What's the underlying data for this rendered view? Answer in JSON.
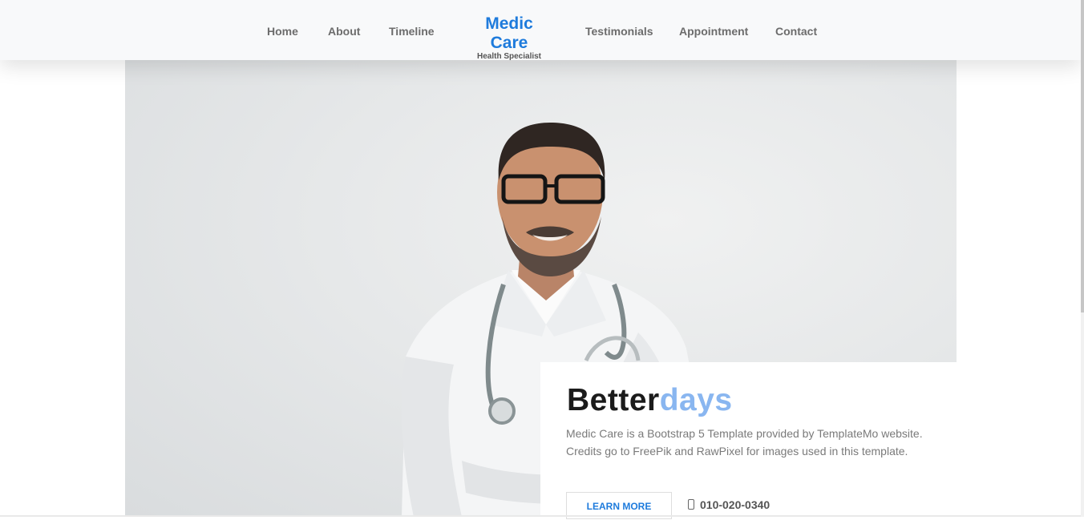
{
  "nav": {
    "items": [
      "Home",
      "About",
      "Timeline",
      "Testimonials",
      "Appointment",
      "Contact"
    ],
    "brand_title": "Medic Care",
    "brand_subtitle": "Health Specialist"
  },
  "hero": {
    "title_main": "Better",
    "title_accent": "days",
    "description": "Medic Care is a Bootstrap 5 Template provided by TemplateMo website. Credits go to FreePik and RawPixel for images used in this template.",
    "button_label": "LEARN MORE",
    "phone": "010-020-0340",
    "image_subject": "doctor with stethoscope"
  },
  "colors": {
    "brand": "#1e7bdc",
    "accent_light": "#89b6f0",
    "navbar_bg": "#f8f9fa"
  },
  "icons": [
    "phone-icon"
  ]
}
